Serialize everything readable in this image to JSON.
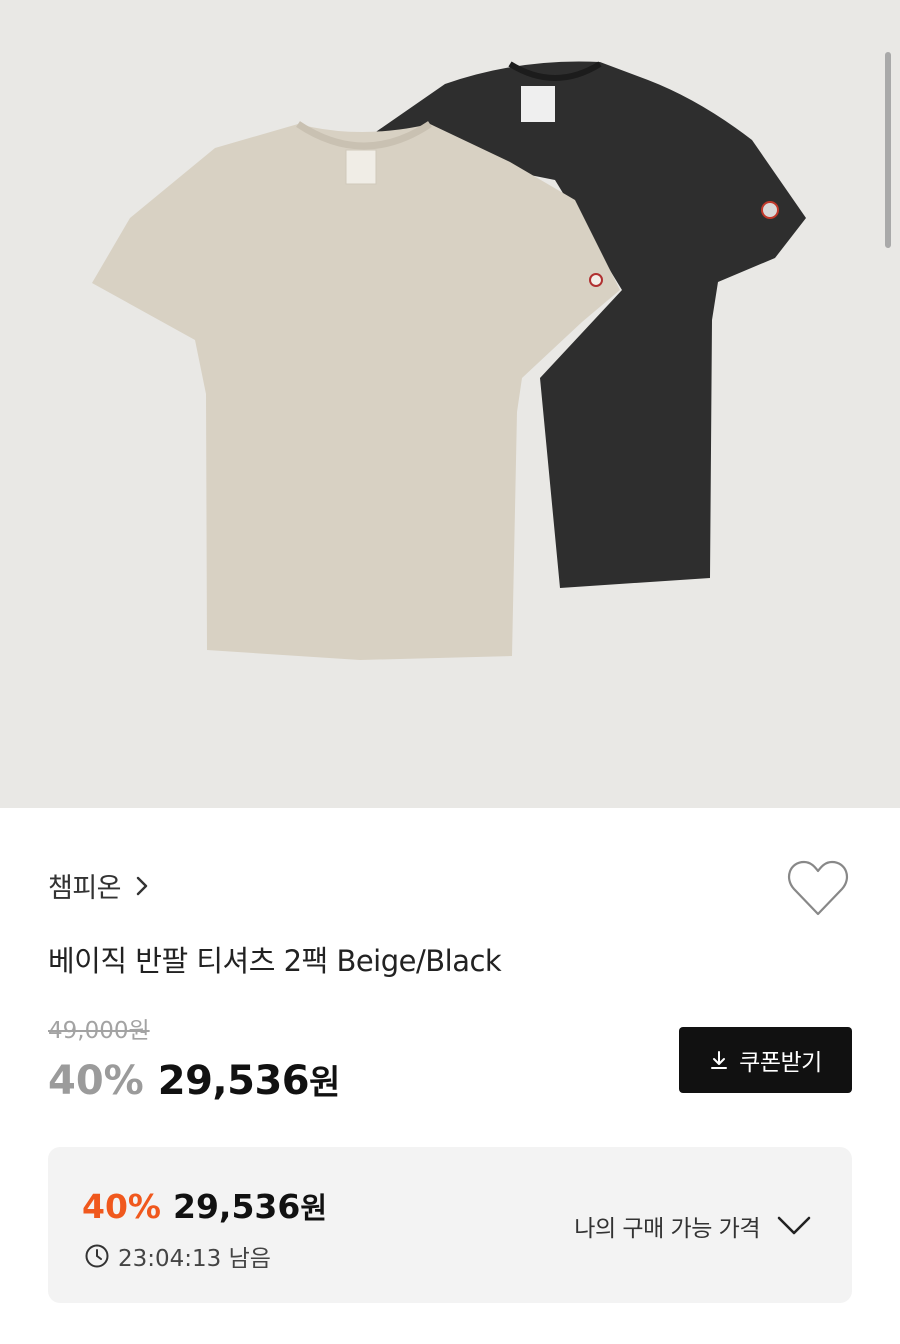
{
  "product": {
    "image_alt": "beige and black t-shirt 2 pack",
    "brand": "챔피온",
    "title": "베이직 반팔 티셔츠 2팩 Beige/Black",
    "original_price": "49,000원",
    "discount": "40%",
    "sale_price": "29,536",
    "currency": "원"
  },
  "coupon": {
    "label": "쿠폰받기",
    "icon": "download-icon"
  },
  "my_price": {
    "discount": "40%",
    "price": "29,536",
    "currency": "원",
    "timer": "23:04:13 남음",
    "label": "나의 구매 가능 가격",
    "icon": "chevron-down-icon"
  },
  "colors": {
    "accent": "#f0581d",
    "button": "#111111",
    "hero_bg": "#e9e8e5"
  }
}
